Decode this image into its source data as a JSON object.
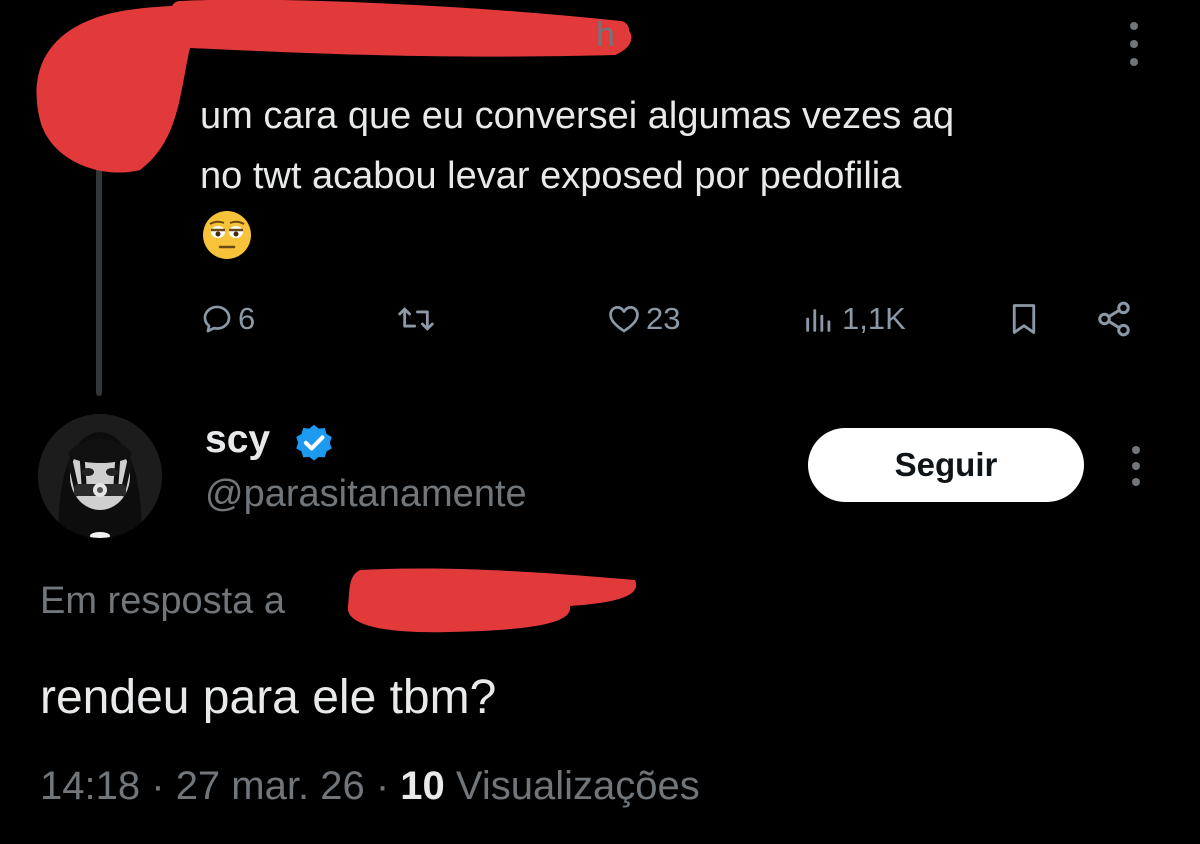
{
  "colors": {
    "background": "#000000",
    "text_primary": "#e7e9ea",
    "text_secondary": "#71767b",
    "redaction": "#e23a3a",
    "verified": "#1d9bf0"
  },
  "parent_tweet": {
    "name_tail": "h",
    "text_line1": "um cara que eu conversei algumas vezes aq",
    "text_line2": "no twt acabou levar exposed por pedofilia",
    "emoji": "flushed-eyes-emoji",
    "actions": {
      "reply_count": "6",
      "retweet_count": "",
      "like_count": "23",
      "views_count": "1,1K"
    },
    "icons": [
      "reply-icon",
      "retweet-icon",
      "like-icon",
      "views-icon",
      "bookmark-icon",
      "share-icon",
      "more-icon"
    ]
  },
  "reply_tweet": {
    "author_name": "scy",
    "handle": "@parasitanamente",
    "follow_label": "Seguir",
    "reply_to_label": "Em resposta a",
    "text": "rendeu para ele tbm?",
    "time": "14:18",
    "date": "27 mar. 26",
    "views_count": "10",
    "views_label": "Visualizações",
    "separator": "·"
  }
}
